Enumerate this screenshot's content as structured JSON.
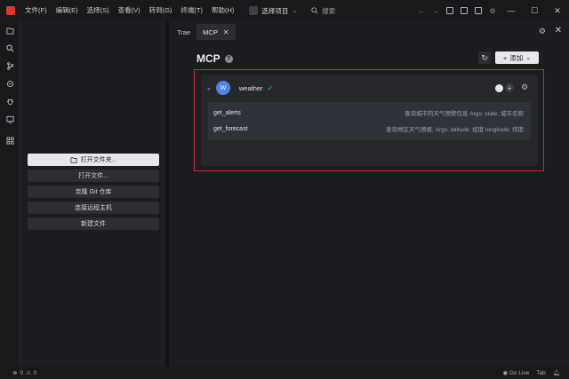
{
  "menu": {
    "items": [
      "文件(F)",
      "编辑(E)",
      "选择(S)",
      "查看(V)",
      "转到(G)",
      "终端(T)",
      "帮助(H)"
    ]
  },
  "project": {
    "label": "选择项目"
  },
  "search": {
    "placeholder": "搜索"
  },
  "sidebar": {
    "buttons": [
      "打开文件夹...",
      "打开文件...",
      "克隆 Git 仓库",
      "连接远程主机",
      "新建文件"
    ]
  },
  "tabs": [
    {
      "label": "Trae"
    },
    {
      "label": "MCP"
    }
  ],
  "mcp": {
    "title": "MCP",
    "add_label": "添加",
    "server": {
      "avatar": "W",
      "name": "weather",
      "tools": [
        {
          "name": "get_alerts",
          "desc": "查询城市的天气预警信息 Args: state: 城市名称"
        },
        {
          "name": "get_forecast",
          "desc": "查询地区天气预报, Args: latitude: 经度 longitude: 纬度"
        }
      ]
    }
  },
  "status": {
    "errors": "0",
    "warnings": "0",
    "golive": "Go Live",
    "tab": "Tab"
  },
  "colors": {
    "accent_red": "#d7242b",
    "avatar_blue": "#4b84e8",
    "check_green": "#39c06a"
  }
}
